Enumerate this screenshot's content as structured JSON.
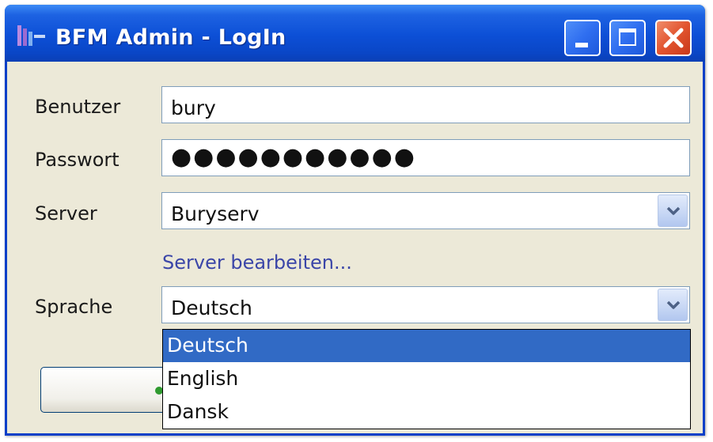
{
  "window": {
    "title": "BFM Admin - LogIn",
    "colors": {
      "titlebar": "#0a46c6",
      "body": "#ece9d8",
      "close": "#e2542f",
      "selection": "#316ac5",
      "link": "#3b46a8"
    }
  },
  "form": {
    "user_label": "Benutzer",
    "user_value": "bury",
    "password_label": "Passwort",
    "password_value": "●●●●●●●●●●●",
    "server_label": "Server",
    "server_value": "Buryserv",
    "edit_server_link": "Server bearbeiten...",
    "language_label": "Sprache",
    "language_value": "Deutsch"
  },
  "language_dropdown": {
    "options": [
      "Deutsch",
      "English",
      "Dansk"
    ],
    "selected_index": 0
  },
  "icons": {
    "app": "app-logo-icon",
    "minimize": "minimize-icon",
    "maximize": "maximize-icon",
    "close": "close-icon",
    "combo": "chevron-down-icon"
  }
}
